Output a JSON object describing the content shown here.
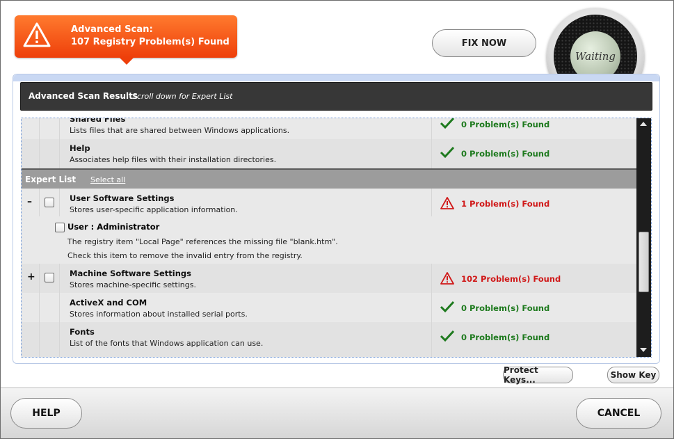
{
  "banner": {
    "line1": "Advanced Scan:",
    "line2": "107 Registry Problem(s) Found",
    "icon": "warning-icon",
    "color": "#ee3f0a"
  },
  "fix_now_label": "FIX NOW",
  "dial": {
    "label": "Waiting"
  },
  "results_header": {
    "title": "Advanced Scan Results",
    "subtitle": "Scroll down for Expert List"
  },
  "rows_top": [
    {
      "title": "Shared Files",
      "desc": "Lists files that are shared between Windows applications.",
      "status": "0 Problem(s) Found"
    },
    {
      "title": "Help",
      "desc": "Associates help files with their installation directories.",
      "status": "0 Problem(s) Found"
    }
  ],
  "expert": {
    "title": "Expert List",
    "select_all": "Select all"
  },
  "expert_rows": [
    {
      "expand": "–",
      "title": "User Software Settings",
      "desc": "Stores user-specific application information.",
      "status": "1 Problem(s) Found",
      "level": "error"
    },
    {
      "expand": "+",
      "title": "Machine Software Settings",
      "desc": "Stores machine-specific settings.",
      "status": "102 Problem(s) Found",
      "level": "error"
    },
    {
      "expand": "",
      "title": "ActiveX and COM",
      "desc": "Stores information about installed serial ports.",
      "status": "0 Problem(s) Found",
      "level": "ok"
    },
    {
      "expand": "",
      "title": "Fonts",
      "desc": "List of the fonts that Windows application can use.",
      "status": "0 Problem(s) Found",
      "level": "ok"
    }
  ],
  "detail": {
    "title": "User : Administrator",
    "line1": "The registry item \"Local Page\" references the missing file \"blank.htm\".",
    "line2": "Check this item to remove the invalid entry from the registry."
  },
  "buttons": {
    "protect_keys": "Protect Keys...",
    "show_key": "Show Key",
    "help": "HELP",
    "cancel": "CANCEL"
  },
  "colors": {
    "ok": "#1e7a1e",
    "error": "#d01818"
  }
}
